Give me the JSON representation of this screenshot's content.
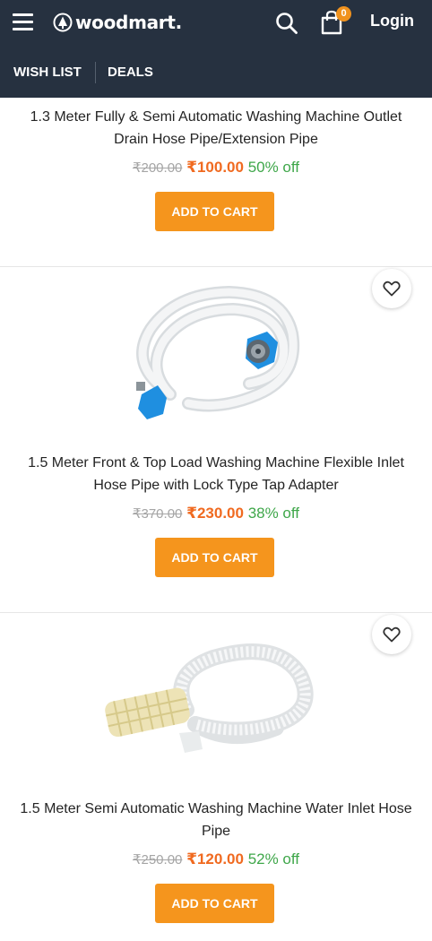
{
  "header": {
    "brand": "woodmart.",
    "cart_count": "0",
    "login_label": "Login",
    "nav": {
      "wishlist_label": "WISH LIST",
      "deals_label": "DEALS"
    }
  },
  "colors": {
    "header_bg": "#263140",
    "accent": "#f5951d",
    "price_new": "#f06a20",
    "discount": "#3fa74a",
    "price_old": "#a5a5a5"
  },
  "products": [
    {
      "title": "1.3 Meter Fully & Semi Automatic Washing Machine Outlet Drain Hose Pipe/Extension Pipe",
      "price_old": "₹200.00",
      "price_new": "₹100.00",
      "discount": "50% off",
      "cta": "ADD TO CART"
    },
    {
      "title": "1.5 Meter Front & Top Load Washing Machine Flexible Inlet Hose Pipe with Lock Type Tap Adapter",
      "price_old": "₹370.00",
      "price_new": "₹230.00",
      "discount": "38% off",
      "cta": "ADD TO CART"
    },
    {
      "title": "1.5 Meter Semi Automatic Washing Machine Water Inlet Hose Pipe",
      "price_old": "₹250.00",
      "price_new": "₹120.00",
      "discount": "52% off",
      "cta": "ADD TO CART"
    }
  ],
  "icons": {
    "menu": "hamburger-menu-icon",
    "search": "search-icon",
    "cart": "shopping-bag-icon",
    "wishlist": "heart-icon"
  }
}
